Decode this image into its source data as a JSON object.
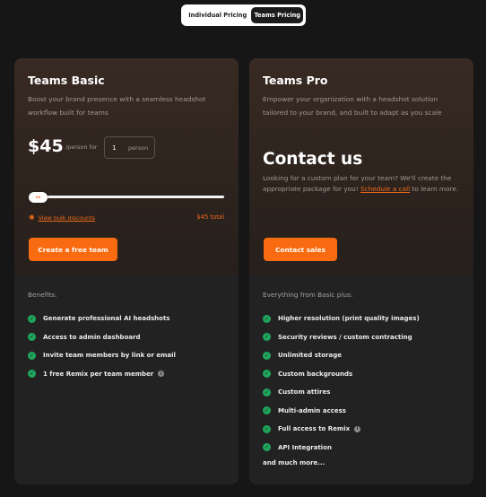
{
  "toggle": {
    "individual": "Individual Pricing",
    "teams": "Teams Pricing"
  },
  "basic": {
    "title": "Teams Basic",
    "description": "Boost your brand presence with a seamless headshot workflow built for teams",
    "price": "$45",
    "per_person": "/person for",
    "quantity": "1",
    "quantity_unit": "person",
    "slider_value": 1,
    "bulk_link": "View bulk discounts",
    "total": "$45 total",
    "cta": "Create a free team",
    "benefits_label": "Benefits:",
    "features": [
      "Generate professional AI headshots",
      "Access to admin dashboard",
      "Invite team members by link or email",
      "1 free Remix per team member"
    ]
  },
  "pro": {
    "title": "Teams Pro",
    "description": "Empower your organization with a headshot solution tailored to your brand, and built to adapt as you scale",
    "contact_title": "Contact us",
    "contact_text_before": "Looking for a custom plan for your team? We'll create the appropriate package for you! ",
    "contact_link": "Schedule a call",
    "contact_text_after": " to learn more.",
    "cta": "Contact sales",
    "benefits_label": "Everything from Basic plus:",
    "features": [
      "Higher resolution (print quality images)",
      "Security reviews / custom contracting",
      "Unlimited storage",
      "Custom backgrounds",
      "Custom attires",
      "Multi-admin access",
      "Full access to Remix",
      "API Integration"
    ],
    "more": "and much more..."
  },
  "colors": {
    "accent": "#f96b10",
    "check": "#1fa65c",
    "background": "#161616"
  },
  "icons": {
    "check": "check-circle-icon",
    "info": "info-icon",
    "discount": "badge-percent-icon",
    "slider": "arrows-left-right-icon"
  }
}
